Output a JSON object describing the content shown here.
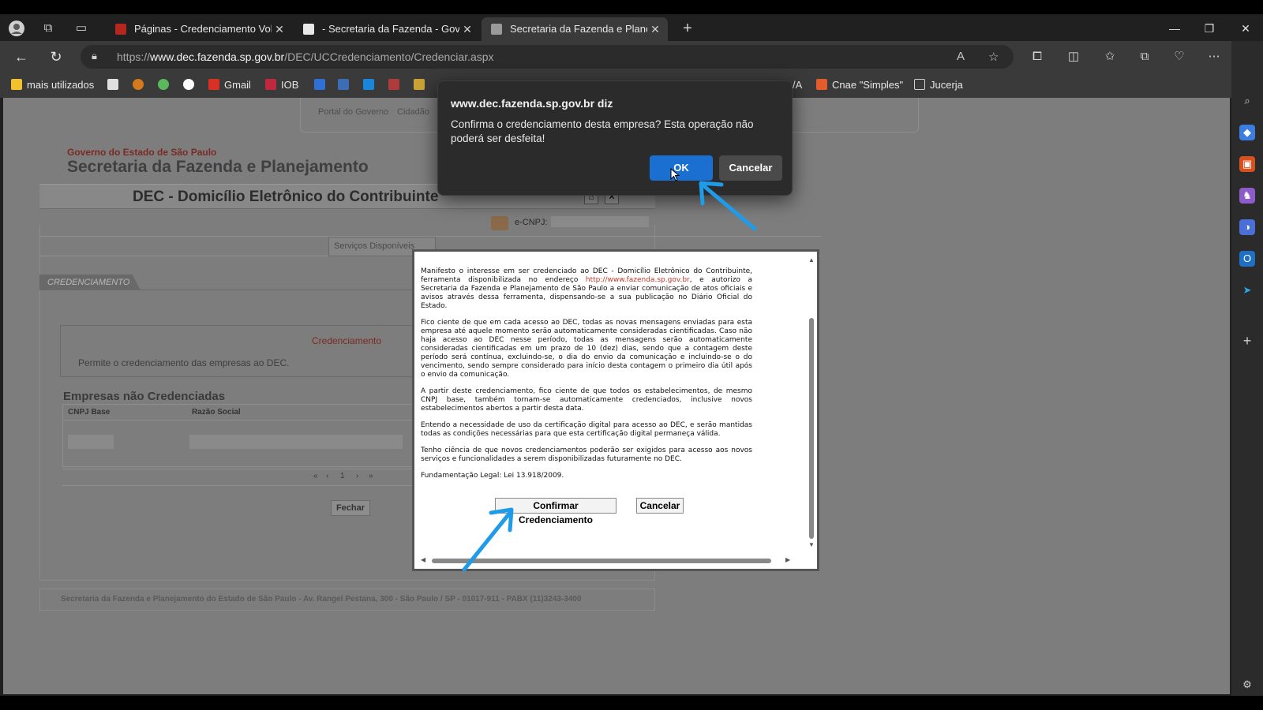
{
  "browser": {
    "tabs": [
      {
        "label": "Páginas - Credenciamento Volun",
        "active": false
      },
      {
        "label": "- Secretaria da Fazenda - Govern",
        "active": false
      },
      {
        "label": "Secretaria da Fazenda e Planejam",
        "active": true
      }
    ],
    "url_prefix": "https://",
    "url_host": "www.dec.fazenda.sp.gov.br",
    "url_path": "/DEC/UCCredenciamento/Credenciar.aspx",
    "bookmarks": [
      "mais utilizados",
      "Gmail",
      "IOB",
      "/A",
      "Cnae \"Simples\"",
      "Jucerja"
    ]
  },
  "page": {
    "topnav": [
      "Portal do Governo",
      "Cidadão"
    ],
    "gov_label": "Governo do Estado de São Paulo",
    "secretaria_title": "Secretaria da Fazenda e Planejamento",
    "dec_title": "DEC - Domicílio Eletrônico do Contribuinte",
    "ecnpj_label": "e-CNPJ:",
    "services_tab": "Serviços Disponíveis",
    "cred_tab": "CREDENCIAMENTO",
    "cred_box_title": "Credenciamento",
    "cred_box_desc": "Permite o credenciamento das empresas ao DEC.",
    "companies_title": "Empresas não Credenciadas",
    "col_cnpj": "CNPJ Base",
    "col_razao": "Razão Social",
    "pager": {
      "first": "«",
      "prev": "‹",
      "page": "1",
      "next": "›",
      "last": "»"
    },
    "close_button": "Fechar",
    "footer": "Secretaria da Fazenda e Planejamento do Estado de São Paulo - Av. Rangel Pestana, 300 - São Paulo / SP - 01017-911 - PABX (11)3243-3400"
  },
  "modal": {
    "p1_a": "Manifesto o interesse em ser credenciado ao DEC - Domicílio Eletrônico do Contribuinte, ferramenta disponibilizada no endereço ",
    "p1_link": "http://www.fazenda.sp.gov.br",
    "p1_b": ", e autorizo a Secretaria da Fazenda e Planejamento de São Paulo a enviar comunicação de atos oficiais e avisos através dessa ferramenta, dispensando-se a sua publicação no Diário Oficial do Estado.",
    "p2": "Fico ciente de que em cada acesso ao DEC, todas as novas mensagens enviadas para esta empresa até aquele momento serão automaticamente consideradas cientificadas. Caso não haja acesso ao DEC nesse período, todas as mensagens serão automaticamente consideradas cientificadas em um prazo de 10 (dez) dias, sendo que a contagem deste período será contínua, excluindo-se, o dia do envio da comunicação e incluindo-se o do vencimento, sendo sempre considerado para início desta contagem o primeiro dia útil após o envio da comunicação.",
    "p3": "A partir deste credenciamento, fico ciente de que todos os estabelecimentos, de mesmo CNPJ base, também tornam-se automaticamente credenciados, inclusive novos estabelecimentos abertos a partir desta data.",
    "p4": "Entendo a necessidade de uso da certificação digital para acesso ao DEC, e serão mantidas todas as condições necessárias para que esta certificação digital permaneça válida.",
    "p5": "Tenho ciência de que novos credenciamentos poderão ser exigidos para acesso aos novos serviços e funcionalidades a serem disponibilizadas futuramente no DEC.",
    "p6": "Fundamentação Legal: Lei 13.918/2009.",
    "confirm_button": "Confirmar Credenciamento",
    "cancel_button": "Cancelar"
  },
  "alert": {
    "title": "www.dec.fazenda.sp.gov.br diz",
    "message": "Confirma o credenciamento desta empresa? Esta operação não poderá ser desfeita!",
    "ok": "OK",
    "cancel": "Cancelar"
  },
  "colors": {
    "accent_blue": "#1a6fd1",
    "annotation_arrow": "#1e9be9",
    "gov_red": "#8c2b22"
  }
}
